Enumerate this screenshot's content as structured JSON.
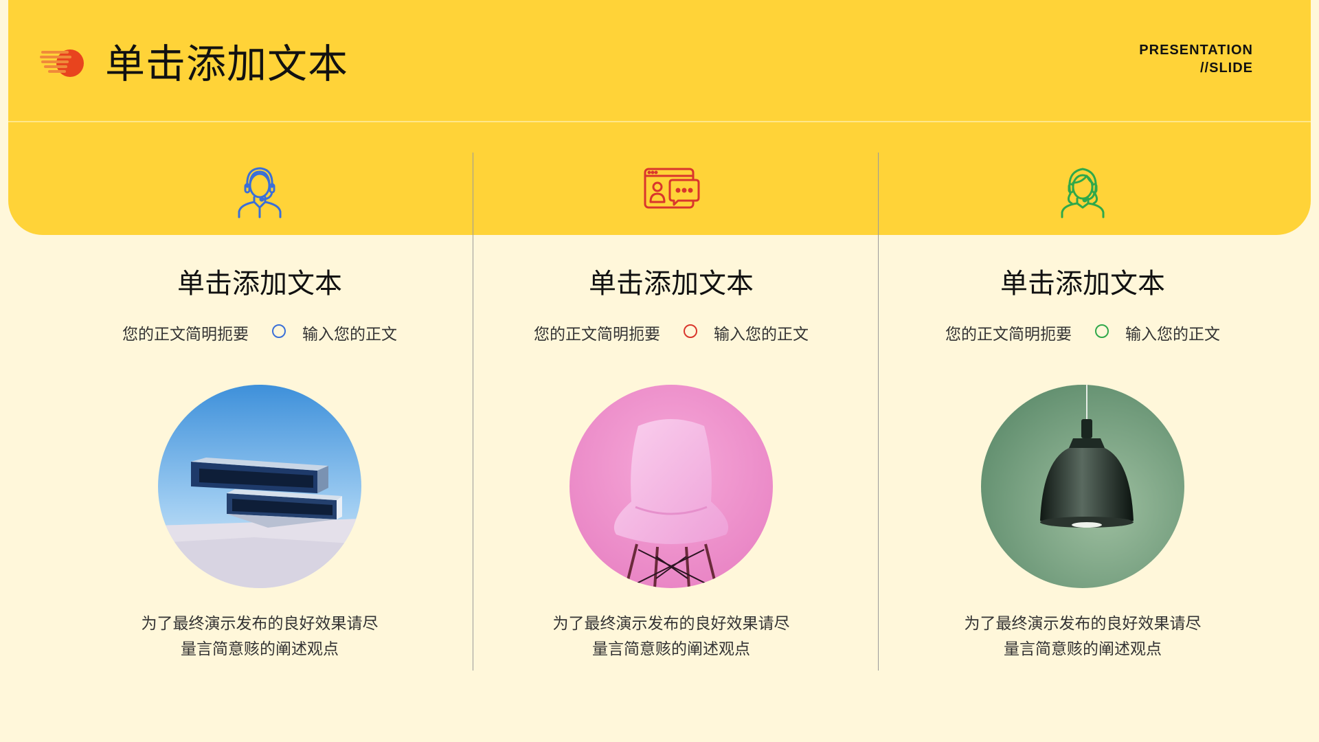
{
  "page": {
    "title": "单击添加文本",
    "brand_line1": "PRESENTATION",
    "brand_line2": "//SLIDE"
  },
  "colors": {
    "background": "#FFF7DA",
    "header": "#FFD338",
    "accent_logo": "#E8441E",
    "col1_accent": "#3A6FD8",
    "col2_accent": "#D9362C",
    "col3_accent": "#2FA84A"
  },
  "columns": [
    {
      "icon": "headset-man-icon",
      "title": "单击添加文本",
      "subtitle_left": "您的正文简明扼要",
      "subtitle_right": "输入您的正文",
      "desc_line1": "为了最终演示发布的良好效果请尽",
      "desc_line2": "量言简意赅的阐述观点",
      "image": "blue-architecture-photo"
    },
    {
      "icon": "video-chat-icon",
      "title": "单击添加文本",
      "subtitle_left": "您的正文简明扼要",
      "subtitle_right": "输入您的正文",
      "desc_line1": "为了最终演示发布的良好效果请尽",
      "desc_line2": "量言简意赅的阐述观点",
      "image": "pink-chair-photo"
    },
    {
      "icon": "headset-woman-icon",
      "title": "单击添加文本",
      "subtitle_left": "您的正文简明扼要",
      "subtitle_right": "输入您的正文",
      "desc_line1": "为了最终演示发布的良好效果请尽",
      "desc_line2": "量言简意赅的阐述观点",
      "image": "green-lamp-photo"
    }
  ]
}
